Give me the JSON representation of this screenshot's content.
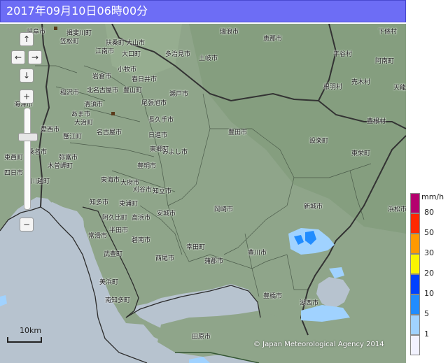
{
  "header": {
    "timestamp": "2017年09月10日06時00分"
  },
  "map": {
    "places": [
      {
        "name": "岐阜市",
        "key": "gifu"
      },
      {
        "name": "揖斐川町",
        "key": "ibigawa"
      },
      {
        "name": "笠松町",
        "key": "kasamatsu"
      },
      {
        "name": "瑞浪市",
        "key": "mizunami"
      },
      {
        "name": "恵那市",
        "key": "ena"
      },
      {
        "name": "下條村",
        "key": "shimojo"
      },
      {
        "name": "扶桑町",
        "key": "fuso"
      },
      {
        "name": "大山市",
        "key": "inuyama"
      },
      {
        "name": "江南市",
        "key": "konan"
      },
      {
        "name": "大口町",
        "key": "oguchi"
      },
      {
        "name": "多治見市",
        "key": "tajimi"
      },
      {
        "name": "土岐市",
        "key": "toki"
      },
      {
        "name": "平谷村",
        "key": "hiraya"
      },
      {
        "name": "阿南町",
        "key": "anan"
      },
      {
        "name": "小牧市",
        "key": "komaki"
      },
      {
        "name": "岩倉市",
        "key": "iwakura"
      },
      {
        "name": "春日井市",
        "key": "kasugai"
      },
      {
        "name": "北名古屋市",
        "key": "kitanagoya"
      },
      {
        "name": "豊山町",
        "key": "toyoyama"
      },
      {
        "name": "稲沢市",
        "key": "inazawa"
      },
      {
        "name": "瀬戸市",
        "key": "seto"
      },
      {
        "name": "根羽村",
        "key": "neba"
      },
      {
        "name": "売木村",
        "key": "urugi"
      },
      {
        "name": "天龍",
        "key": "tenryu"
      },
      {
        "name": "海津市",
        "key": "kaizu"
      },
      {
        "name": "清須市",
        "key": "kiyosu"
      },
      {
        "name": "尾張旭市",
        "key": "owariasahi"
      },
      {
        "name": "あま市",
        "key": "ama"
      },
      {
        "name": "大治町",
        "key": "oharu"
      },
      {
        "name": "長久手市",
        "key": "nagakute"
      },
      {
        "name": "豊根村",
        "key": "toyone"
      },
      {
        "name": "愛西市",
        "key": "aisai"
      },
      {
        "name": "名古屋市",
        "key": "nagoya"
      },
      {
        "name": "日進市",
        "key": "nisshin"
      },
      {
        "name": "豊田市",
        "key": "toyota"
      },
      {
        "name": "設楽町",
        "key": "shitara"
      },
      {
        "name": "蟹江町",
        "key": "kanie"
      },
      {
        "name": "東員町",
        "key": "toin"
      },
      {
        "name": "桑名市",
        "key": "kuwana"
      },
      {
        "name": "弥富市",
        "key": "tobishima"
      },
      {
        "name": "木曽岬町",
        "key": "kisosaki"
      },
      {
        "name": "東郷町",
        "key": "togo"
      },
      {
        "name": "みよし市",
        "key": "miyoshi"
      },
      {
        "name": "東栄町",
        "key": "toei"
      },
      {
        "name": "四日市",
        "key": "yokkaichi"
      },
      {
        "name": "川越町",
        "key": "kawagoe"
      },
      {
        "name": "豊明市",
        "key": "toyoake"
      },
      {
        "name": "東海市",
        "key": "tokai"
      },
      {
        "name": "大府市",
        "key": "obu"
      },
      {
        "name": "刈谷市",
        "key": "kariya"
      },
      {
        "name": "知立市",
        "key": "chiryu"
      },
      {
        "name": "知多市",
        "key": "chita"
      },
      {
        "name": "東浦町",
        "key": "higashiura"
      },
      {
        "name": "岡崎市",
        "key": "okazaki"
      },
      {
        "name": "新城市",
        "key": "shinshiro"
      },
      {
        "name": "浜松市",
        "key": "hamamatsu"
      },
      {
        "name": "阿久比町",
        "key": "agui"
      },
      {
        "name": "高浜市",
        "key": "takahama"
      },
      {
        "name": "安城市",
        "key": "anjo"
      },
      {
        "name": "常滑市",
        "key": "tokoname"
      },
      {
        "name": "半田市",
        "key": "handa"
      },
      {
        "name": "碧南市",
        "key": "hekinan"
      },
      {
        "name": "幸田町",
        "key": "kota"
      },
      {
        "name": "武豊町",
        "key": "taketoyo"
      },
      {
        "name": "西尾市",
        "key": "nishio"
      },
      {
        "name": "豊川市",
        "key": "toyokawa"
      },
      {
        "name": "蒲郡市",
        "key": "gamagori"
      },
      {
        "name": "美浜町",
        "key": "mihama"
      },
      {
        "name": "豊橋市",
        "key": "toyohashi"
      },
      {
        "name": "南知多町",
        "key": "minamichita"
      },
      {
        "name": "湖西市",
        "key": "kosai"
      },
      {
        "name": "田原市",
        "key": "tahara"
      }
    ],
    "scale_label": "10km",
    "copyright": "© Japan Meteorological Agency 2014"
  },
  "controls": {
    "pan_up": "↑",
    "pan_left": "←",
    "pan_right": "→",
    "pan_down": "↓",
    "zoom_in": "+",
    "zoom_out": "−"
  },
  "legend": {
    "unit": "mm/h",
    "levels": [
      {
        "label": "80",
        "color": "#b4006e"
      },
      {
        "label": "50",
        "color": "#ff2800"
      },
      {
        "label": "30",
        "color": "#ff9900"
      },
      {
        "label": "20",
        "color": "#faf500"
      },
      {
        "label": "10",
        "color": "#0041ff"
      },
      {
        "label": "5",
        "color": "#218cff"
      },
      {
        "label": "1",
        "color": "#a0d2ff"
      },
      {
        "label": "",
        "color": "#f2f2ff"
      }
    ]
  },
  "colors": {
    "land": "#8fa58a",
    "sea": "#b7c3cf",
    "title_bar": "#6d6df5",
    "rain_light": "#a0d2ff",
    "rain_moderate": "#218cff"
  }
}
